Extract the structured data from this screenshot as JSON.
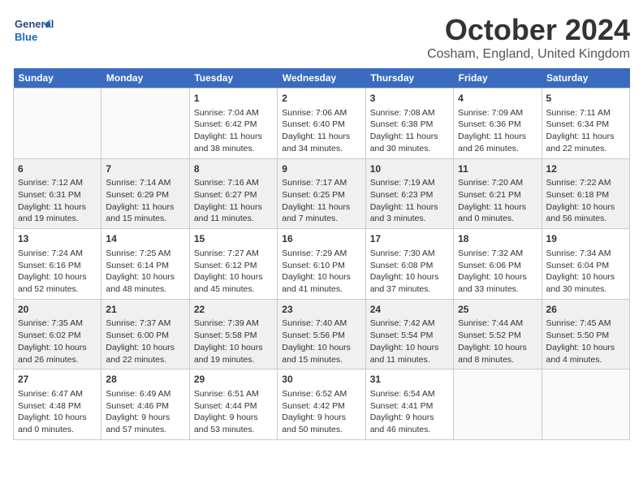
{
  "header": {
    "logo_line1": "General",
    "logo_line2": "Blue",
    "month": "October 2024",
    "location": "Cosham, England, United Kingdom"
  },
  "weekdays": [
    "Sunday",
    "Monday",
    "Tuesday",
    "Wednesday",
    "Thursday",
    "Friday",
    "Saturday"
  ],
  "weeks": [
    [
      {
        "day": "",
        "content": ""
      },
      {
        "day": "",
        "content": ""
      },
      {
        "day": "1",
        "content": "Sunrise: 7:04 AM\nSunset: 6:42 PM\nDaylight: 11 hours\nand 38 minutes."
      },
      {
        "day": "2",
        "content": "Sunrise: 7:06 AM\nSunset: 6:40 PM\nDaylight: 11 hours\nand 34 minutes."
      },
      {
        "day": "3",
        "content": "Sunrise: 7:08 AM\nSunset: 6:38 PM\nDaylight: 11 hours\nand 30 minutes."
      },
      {
        "day": "4",
        "content": "Sunrise: 7:09 AM\nSunset: 6:36 PM\nDaylight: 11 hours\nand 26 minutes."
      },
      {
        "day": "5",
        "content": "Sunrise: 7:11 AM\nSunset: 6:34 PM\nDaylight: 11 hours\nand 22 minutes."
      }
    ],
    [
      {
        "day": "6",
        "content": "Sunrise: 7:12 AM\nSunset: 6:31 PM\nDaylight: 11 hours\nand 19 minutes."
      },
      {
        "day": "7",
        "content": "Sunrise: 7:14 AM\nSunset: 6:29 PM\nDaylight: 11 hours\nand 15 minutes."
      },
      {
        "day": "8",
        "content": "Sunrise: 7:16 AM\nSunset: 6:27 PM\nDaylight: 11 hours\nand 11 minutes."
      },
      {
        "day": "9",
        "content": "Sunrise: 7:17 AM\nSunset: 6:25 PM\nDaylight: 11 hours\nand 7 minutes."
      },
      {
        "day": "10",
        "content": "Sunrise: 7:19 AM\nSunset: 6:23 PM\nDaylight: 11 hours\nand 3 minutes."
      },
      {
        "day": "11",
        "content": "Sunrise: 7:20 AM\nSunset: 6:21 PM\nDaylight: 11 hours\nand 0 minutes."
      },
      {
        "day": "12",
        "content": "Sunrise: 7:22 AM\nSunset: 6:18 PM\nDaylight: 10 hours\nand 56 minutes."
      }
    ],
    [
      {
        "day": "13",
        "content": "Sunrise: 7:24 AM\nSunset: 6:16 PM\nDaylight: 10 hours\nand 52 minutes."
      },
      {
        "day": "14",
        "content": "Sunrise: 7:25 AM\nSunset: 6:14 PM\nDaylight: 10 hours\nand 48 minutes."
      },
      {
        "day": "15",
        "content": "Sunrise: 7:27 AM\nSunset: 6:12 PM\nDaylight: 10 hours\nand 45 minutes."
      },
      {
        "day": "16",
        "content": "Sunrise: 7:29 AM\nSunset: 6:10 PM\nDaylight: 10 hours\nand 41 minutes."
      },
      {
        "day": "17",
        "content": "Sunrise: 7:30 AM\nSunset: 6:08 PM\nDaylight: 10 hours\nand 37 minutes."
      },
      {
        "day": "18",
        "content": "Sunrise: 7:32 AM\nSunset: 6:06 PM\nDaylight: 10 hours\nand 33 minutes."
      },
      {
        "day": "19",
        "content": "Sunrise: 7:34 AM\nSunset: 6:04 PM\nDaylight: 10 hours\nand 30 minutes."
      }
    ],
    [
      {
        "day": "20",
        "content": "Sunrise: 7:35 AM\nSunset: 6:02 PM\nDaylight: 10 hours\nand 26 minutes."
      },
      {
        "day": "21",
        "content": "Sunrise: 7:37 AM\nSunset: 6:00 PM\nDaylight: 10 hours\nand 22 minutes."
      },
      {
        "day": "22",
        "content": "Sunrise: 7:39 AM\nSunset: 5:58 PM\nDaylight: 10 hours\nand 19 minutes."
      },
      {
        "day": "23",
        "content": "Sunrise: 7:40 AM\nSunset: 5:56 PM\nDaylight: 10 hours\nand 15 minutes."
      },
      {
        "day": "24",
        "content": "Sunrise: 7:42 AM\nSunset: 5:54 PM\nDaylight: 10 hours\nand 11 minutes."
      },
      {
        "day": "25",
        "content": "Sunrise: 7:44 AM\nSunset: 5:52 PM\nDaylight: 10 hours\nand 8 minutes."
      },
      {
        "day": "26",
        "content": "Sunrise: 7:45 AM\nSunset: 5:50 PM\nDaylight: 10 hours\nand 4 minutes."
      }
    ],
    [
      {
        "day": "27",
        "content": "Sunrise: 6:47 AM\nSunset: 4:48 PM\nDaylight: 10 hours\nand 0 minutes."
      },
      {
        "day": "28",
        "content": "Sunrise: 6:49 AM\nSunset: 4:46 PM\nDaylight: 9 hours\nand 57 minutes."
      },
      {
        "day": "29",
        "content": "Sunrise: 6:51 AM\nSunset: 4:44 PM\nDaylight: 9 hours\nand 53 minutes."
      },
      {
        "day": "30",
        "content": "Sunrise: 6:52 AM\nSunset: 4:42 PM\nDaylight: 9 hours\nand 50 minutes."
      },
      {
        "day": "31",
        "content": "Sunrise: 6:54 AM\nSunset: 4:41 PM\nDaylight: 9 hours\nand 46 minutes."
      },
      {
        "day": "",
        "content": ""
      },
      {
        "day": "",
        "content": ""
      }
    ]
  ]
}
